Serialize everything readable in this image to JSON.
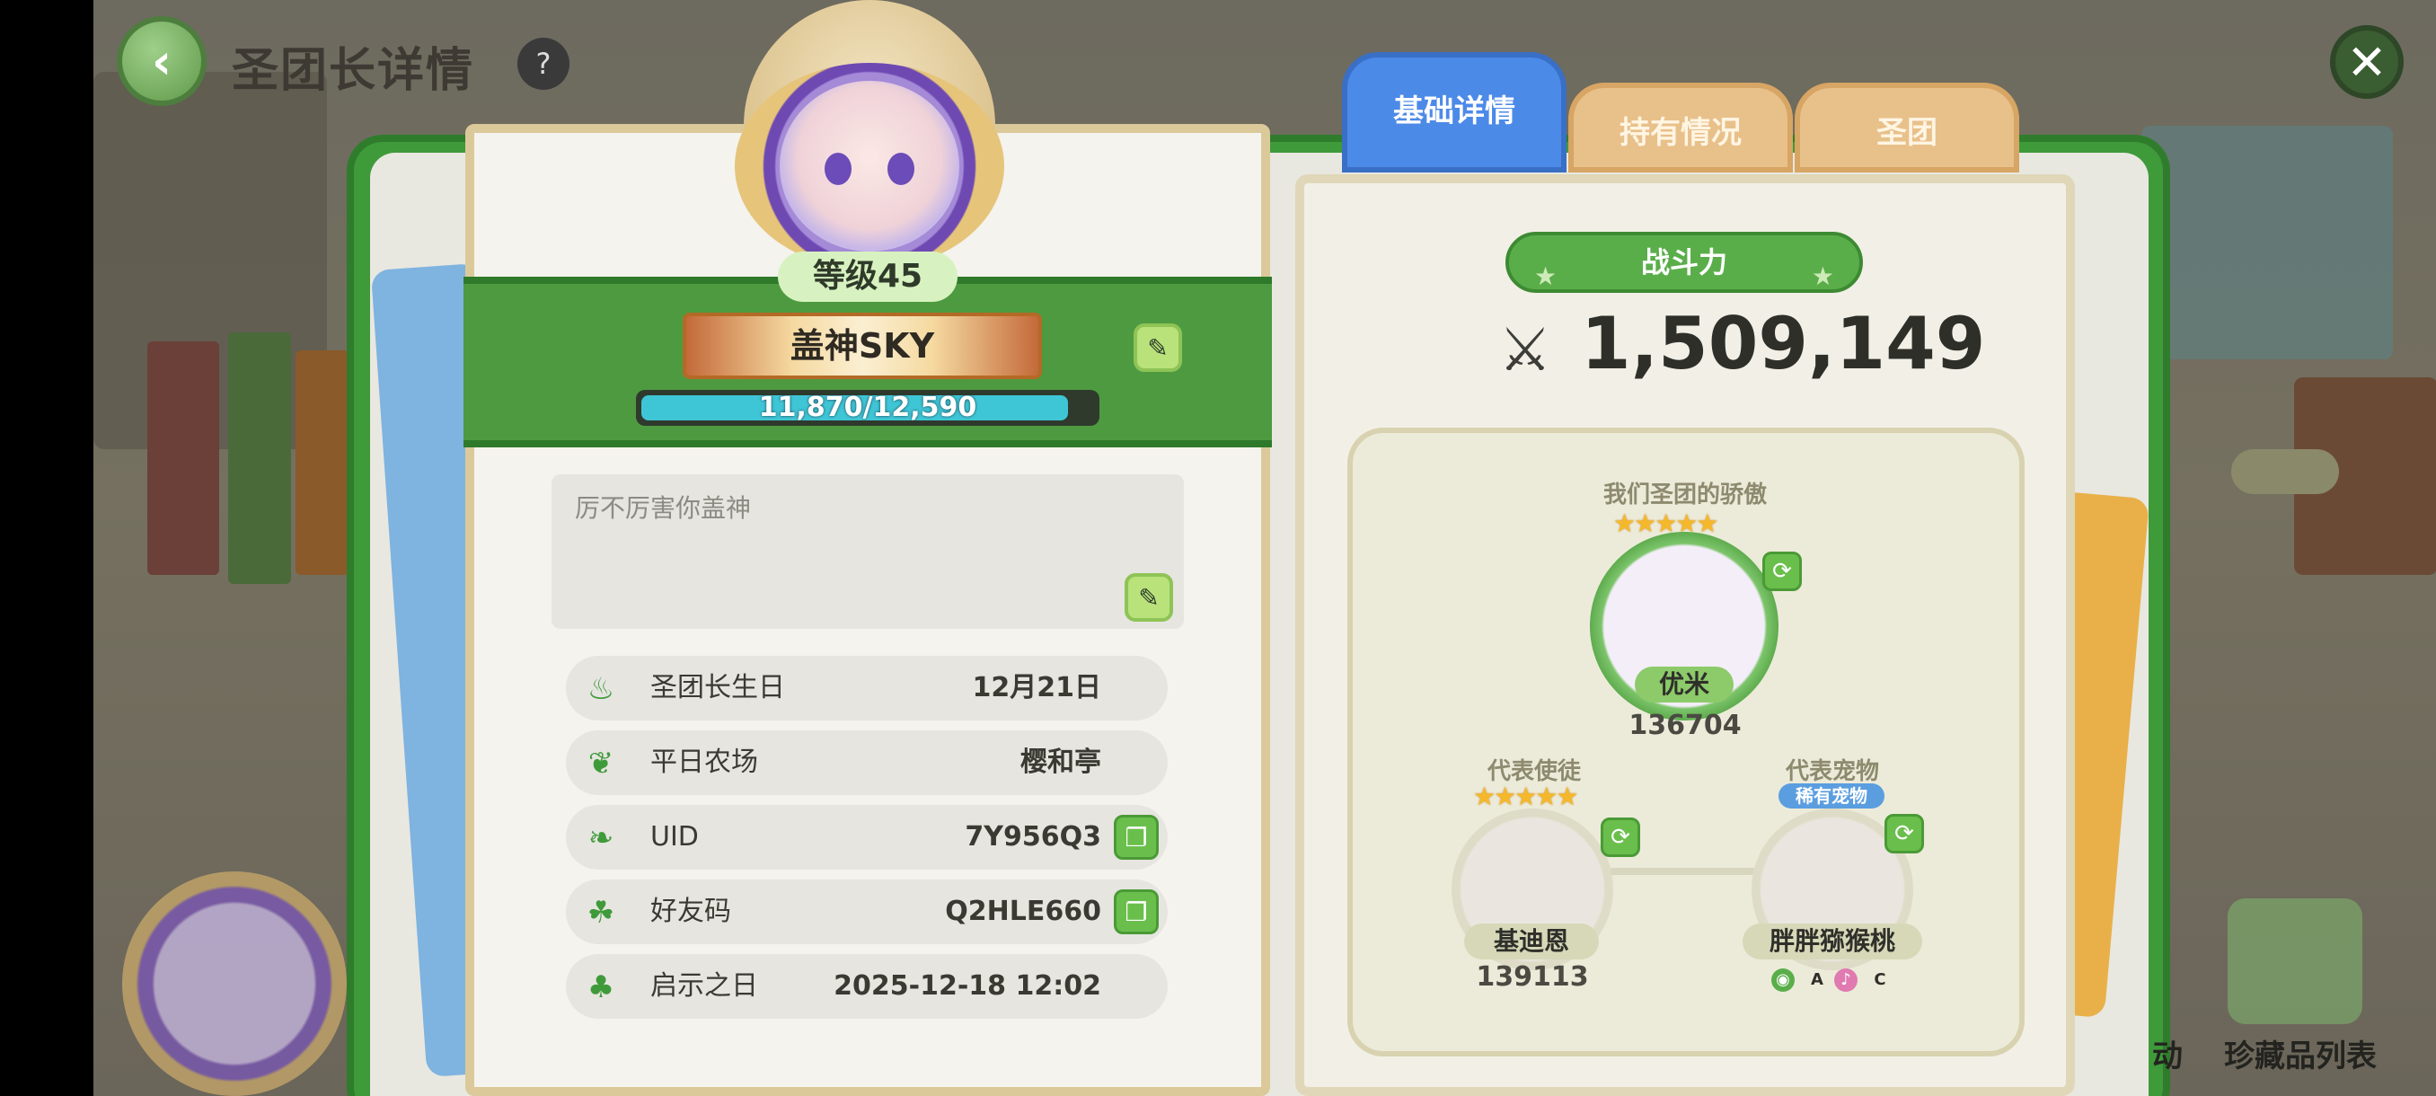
{
  "header": {
    "title": "圣团长详情",
    "back_icon": "‹",
    "help_icon": "?",
    "close_icon": "✕"
  },
  "profile": {
    "level_label": "等级45",
    "name": "盖神SKY",
    "xp_text": "11,870/12,590",
    "xp_fraction": 0.943,
    "bio": "厉不厉害你盖神",
    "edit_icon": "✎"
  },
  "info_rows": [
    {
      "label": "圣团长生日",
      "value": "12月21日",
      "icon": "cake-icon",
      "copyable": false
    },
    {
      "label": "平日农场",
      "value": "樱和亭",
      "icon": "radish-icon",
      "copyable": false
    },
    {
      "label": "UID",
      "value": "7Y956Q3",
      "icon": "leaf-icon",
      "copyable": true
    },
    {
      "label": "好友码",
      "value": "Q2HLE660",
      "icon": "friends-icon",
      "copyable": true
    },
    {
      "label": "启示之日",
      "value": "2025-12-18 12:02",
      "icon": "sprout-icon",
      "copyable": false
    }
  ],
  "tabs": [
    {
      "label": "基础详情",
      "active": true
    },
    {
      "label": "持有情况",
      "active": false
    },
    {
      "label": "圣团",
      "active": false
    }
  ],
  "power": {
    "label": "战斗力",
    "value": "1,509,149"
  },
  "pride": {
    "title": "我们圣团的骄傲",
    "stars": "★★★★★",
    "name": "优米",
    "value": "136704"
  },
  "apostle": {
    "title": "代表使徒",
    "stars": "★★★★★",
    "name": "基迪恩",
    "value": "139113"
  },
  "pet": {
    "title": "代表宠物",
    "badge": "稀有宠物",
    "name": "胖胖猕猴桃",
    "grades": [
      "A",
      "C"
    ]
  },
  "bottom": {
    "collection_label": "珍藏品列表",
    "partial_label": "动"
  },
  "colors": {
    "accent_green": "#4e9a40",
    "tab_active": "#4c8ae8",
    "tab_inactive": "#e8c08a",
    "xp_fill": "#3fc6d6"
  }
}
